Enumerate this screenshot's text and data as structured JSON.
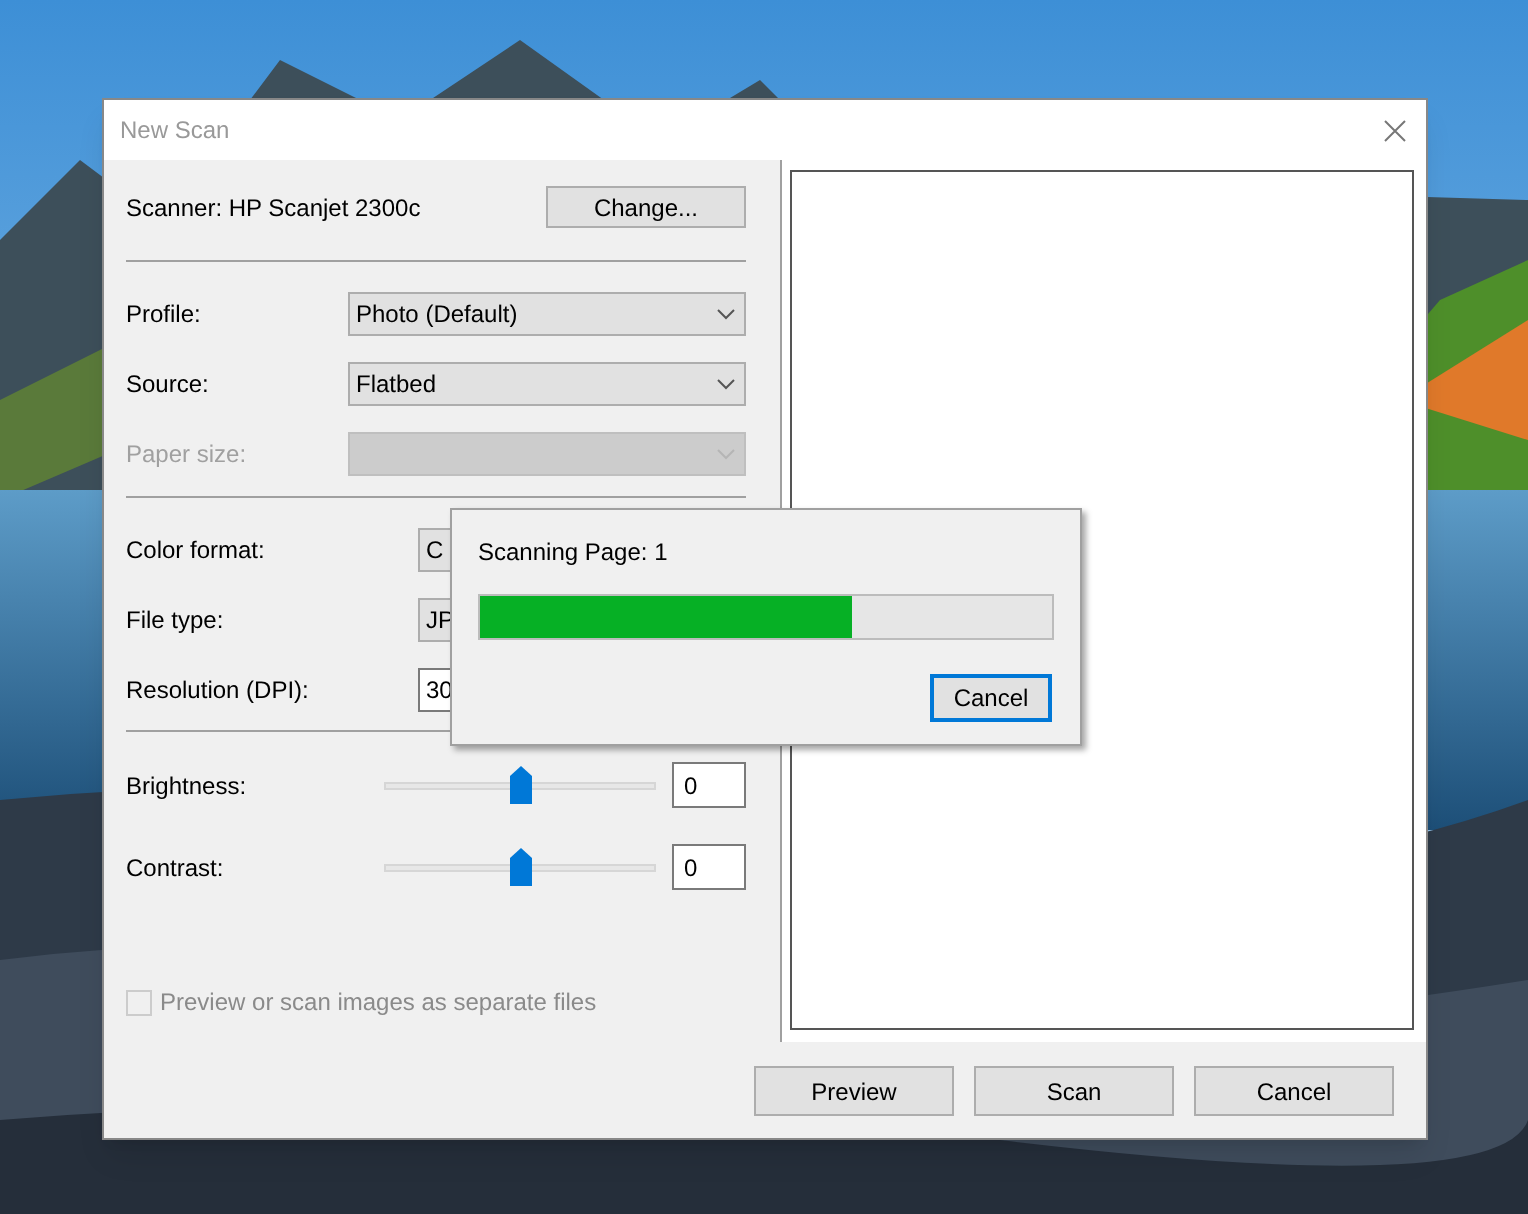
{
  "window": {
    "title": "New Scan"
  },
  "scanner": {
    "label": "Scanner: HP Scanjet 2300c",
    "button": "Change..."
  },
  "source_settings": [
    {
      "kind": "select",
      "label": "Profile:",
      "value": "Photo (Default)",
      "disabled": false
    },
    {
      "kind": "select",
      "label": "Source:",
      "value": "Flatbed",
      "disabled": false
    },
    {
      "kind": "select",
      "label": "Paper size:",
      "disabled": true
    }
  ],
  "format_settings": [
    {
      "kind": "select",
      "label": "Color format:",
      "value": "C",
      "disabled": false
    },
    {
      "kind": "select",
      "label": "File type:",
      "value": "JP",
      "disabled": false
    },
    {
      "kind": "input",
      "label": "Resolution (DPI):",
      "value": "30",
      "disabled": false
    }
  ],
  "sliders": [
    {
      "label": "Brightness:",
      "level": 0.5,
      "value": "0"
    },
    {
      "label": "Contrast:",
      "level": 0.5,
      "value": "0"
    }
  ],
  "option": {
    "label": "Preview or scan images as separate files",
    "checked": false,
    "disabled": true
  },
  "buttons": [
    "Preview",
    "Scan",
    "Cancel"
  ],
  "progress": {
    "title": "Scanning Page: 1",
    "level": 0.65,
    "button": "Cancel"
  }
}
